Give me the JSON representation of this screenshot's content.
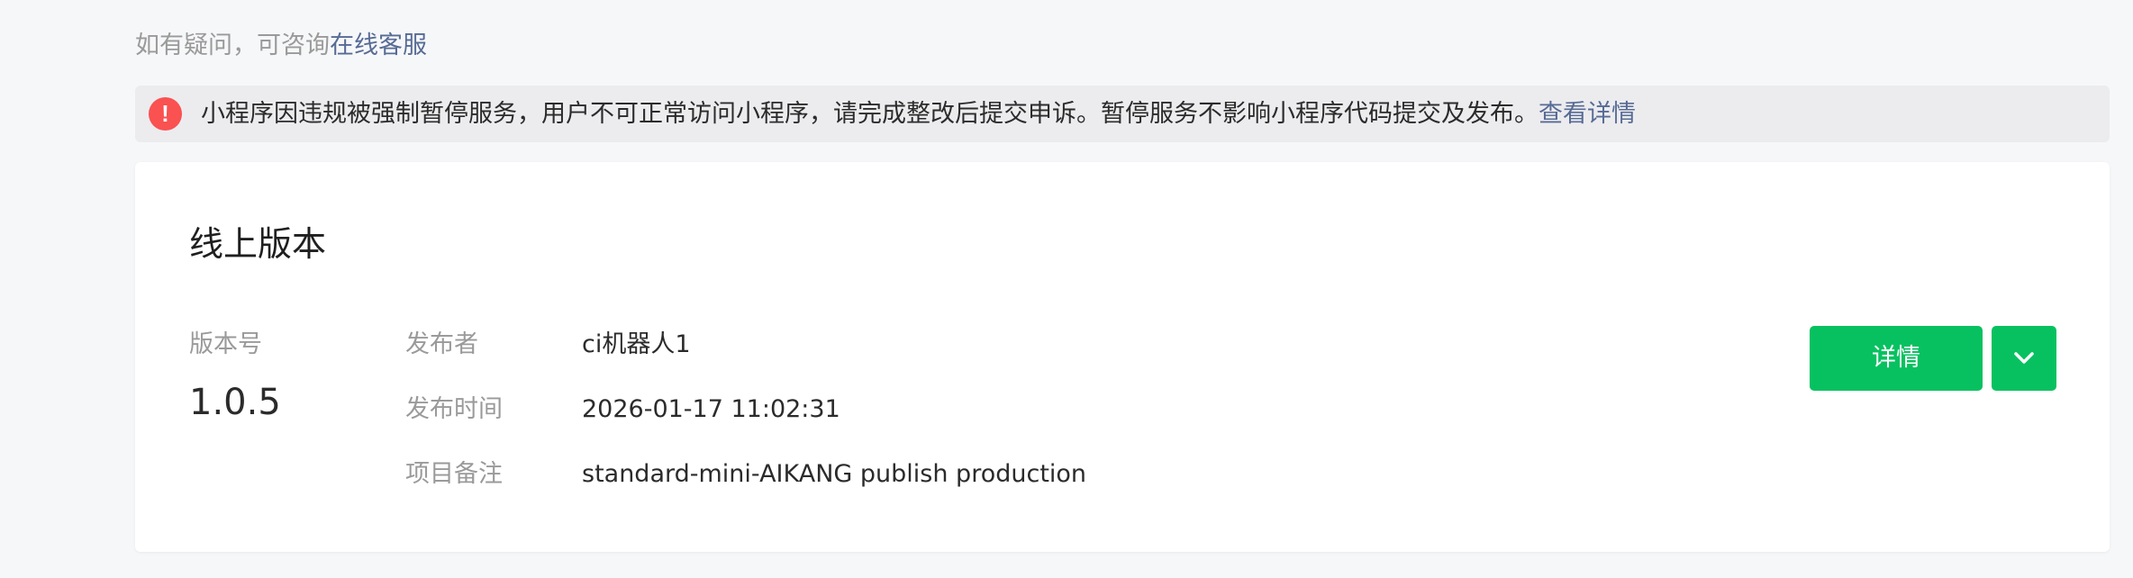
{
  "help": {
    "prefix": "如有疑问，可咨询",
    "link": "在线客服"
  },
  "notice": {
    "icon": "!",
    "text": "小程序因违规被强制暂停服务，用户不可正常访问小程序，请完成整改后提交申诉。暂停服务不影响小程序代码提交及发布。",
    "link": "查看详情"
  },
  "card": {
    "title": "线上版本",
    "version_label": "版本号",
    "version_number": "1.0.5",
    "rows": [
      {
        "label": "发布者",
        "value": "ci机器人1"
      },
      {
        "label": "发布时间",
        "value": "2026-01-17 11:02:31"
      },
      {
        "label": "项目备注",
        "value": "standard-mini-AIKANG publish production"
      }
    ],
    "detail_button": "详情",
    "more_icon": "chevron-down-icon"
  },
  "colors": {
    "primary_green": "#07c160",
    "link_blue": "#576b95",
    "warning_red": "#fa5151"
  }
}
